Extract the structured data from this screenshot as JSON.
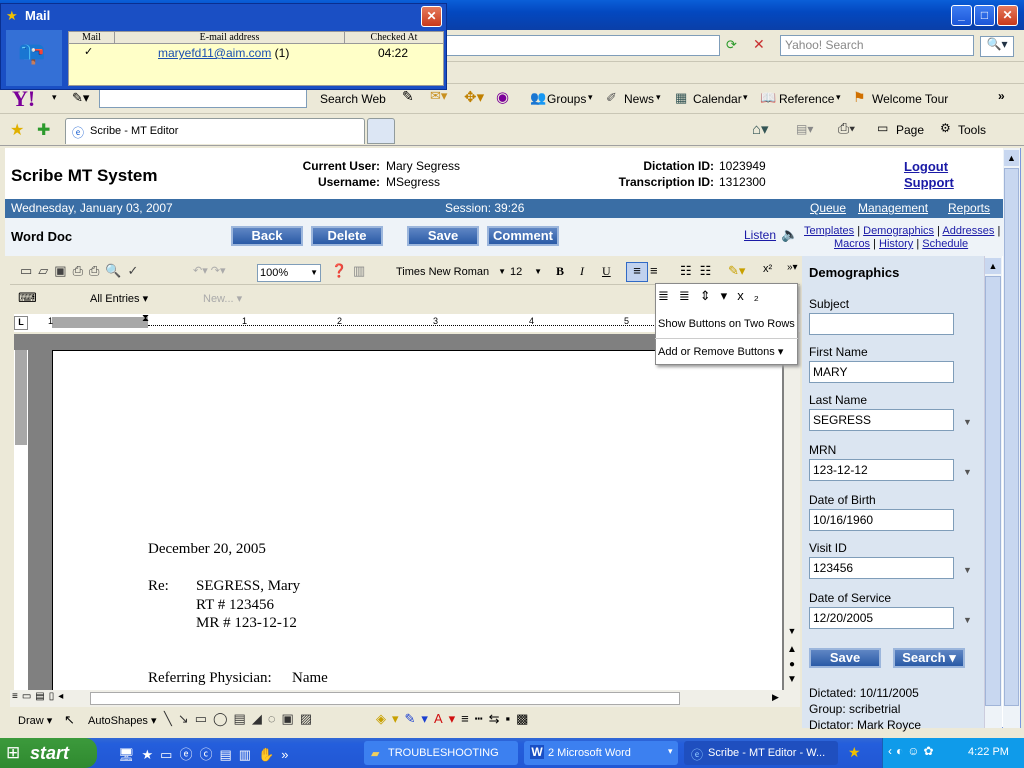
{
  "browser": {
    "search_placeholder": "Yahoo! Search",
    "tab_title": "Scribe - MT Editor",
    "page_label": "Page",
    "tools_label": "Tools"
  },
  "yahoo_toolbar": {
    "search_web": "Search Web",
    "groups": "Groups",
    "news": "News",
    "calendar": "Calendar",
    "reference": "Reference",
    "welcome_tour": "Welcome Tour"
  },
  "mail_popup": {
    "title": "Mail",
    "col_mail": "Mail",
    "col_email": "E-mail address",
    "col_checked": "Checked At",
    "check": "✓",
    "email": "maryefd11@aim.com",
    "count": "(1)",
    "time": "04:22"
  },
  "header": {
    "app_title": "Scribe MT System",
    "current_user_label": "Current User:",
    "current_user": "Mary Segress",
    "username_label": "Username:",
    "username": "MSegress",
    "dictation_label": "Dictation ID:",
    "dictation_id": "1023949",
    "transcription_label": "Transcription ID:",
    "transcription_id": "1312300",
    "logout": "Logout",
    "support": "Support"
  },
  "statusbar": {
    "date": "Wednesday, January 03, 2007",
    "session": "Session: 39:26",
    "queue": "Queue",
    "management": "Management",
    "reports": "Reports"
  },
  "actions": {
    "word_doc": "Word Doc",
    "back": "Back",
    "delete": "Delete",
    "save": "Save",
    "comment": "Comment",
    "listen": "Listen"
  },
  "links": {
    "templates": "Templates",
    "demographics": "Demographics",
    "addresses": "Addresses",
    "macros": "Macros",
    "history": "History",
    "schedule": "Schedule"
  },
  "word": {
    "zoom": "100%",
    "font": "Times New Roman",
    "size": "12",
    "all_entries": "All Entries",
    "new": "New...",
    "draw": "Draw",
    "autoshapes": "AutoShapes",
    "popup_show_two_rows": "Show Buttons on Two Rows",
    "popup_add_remove": "Add or Remove Buttons"
  },
  "document": {
    "date": "December 20, 2005",
    "re_label": "Re:",
    "patient": "SEGRESS, Mary",
    "rt": "RT # 123456",
    "mr": "MR # 123-12-12",
    "ref_label": "Referring Physician:",
    "ref_value": "Name"
  },
  "demographics": {
    "title": "Demographics",
    "subject_label": "Subject",
    "subject": "",
    "first_name_label": "First Name",
    "first_name": "MARY",
    "last_name_label": "Last Name",
    "last_name": "SEGRESS",
    "mrn_label": "MRN",
    "mrn": "123-12-12",
    "dob_label": "Date of Birth",
    "dob": "10/16/1960",
    "visit_label": "Visit ID",
    "visit": "123456",
    "dos_label": "Date of Service",
    "dos": "12/20/2005",
    "save": "Save",
    "search": "Search",
    "dictated": "Dictated: 10/11/2005",
    "group": "Group: scribetrial",
    "dictator": "Dictator: Mark Royce"
  },
  "taskbar": {
    "start": "start",
    "t1": "TROUBLESHOOTING",
    "t2": "2 Microsoft Word",
    "t3": "Scribe - MT Editor - W...",
    "clock": "4:22 PM"
  }
}
